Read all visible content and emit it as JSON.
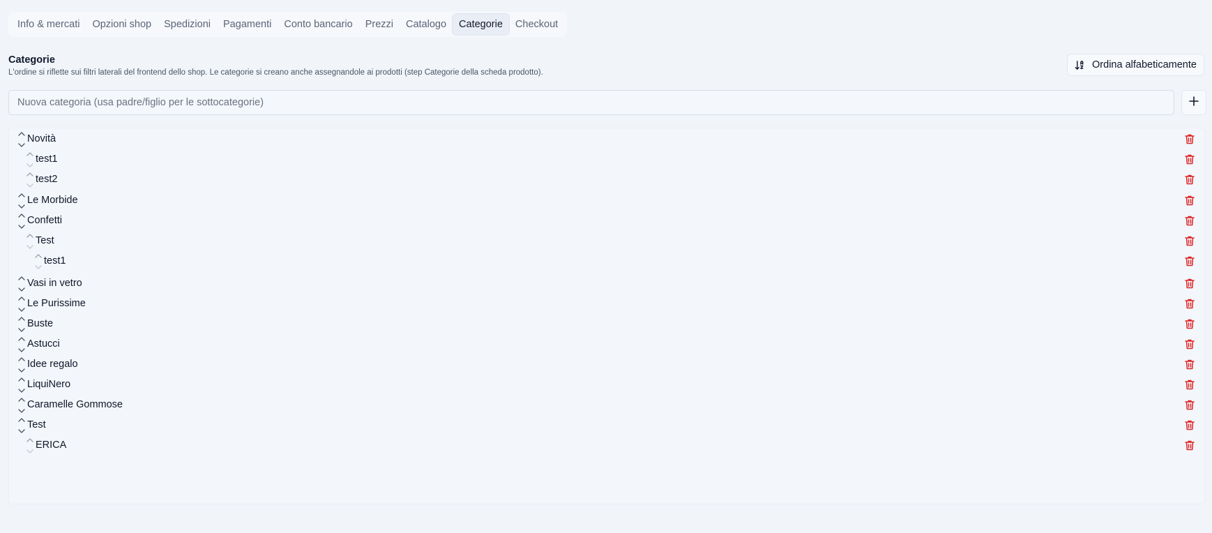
{
  "tabs": [
    {
      "label": "Info & mercati",
      "active": false
    },
    {
      "label": "Opzioni shop",
      "active": false
    },
    {
      "label": "Spedizioni",
      "active": false
    },
    {
      "label": "Pagamenti",
      "active": false
    },
    {
      "label": "Conto bancario",
      "active": false
    },
    {
      "label": "Prezzi",
      "active": false
    },
    {
      "label": "Catalogo",
      "active": false
    },
    {
      "label": "Categorie",
      "active": true
    },
    {
      "label": "Checkout",
      "active": false
    }
  ],
  "section": {
    "title": "Categorie",
    "description": "L'ordine si riflette sui filtri laterali del frontend dello shop. Le categorie si creano anche assegnandole ai prodotti (step Categorie della scheda prodotto)."
  },
  "sort_button": {
    "label": "Ordina alfabeticamente",
    "icon": "sort-alpha-icon"
  },
  "new_category": {
    "placeholder": "Nuova categoria (usa padre/figlio per le sottocategorie)",
    "value": ""
  },
  "add_button": {
    "icon": "plus-icon"
  },
  "categories": [
    {
      "label": "Novità",
      "depth": 0
    },
    {
      "label": "test1",
      "depth": 1
    },
    {
      "label": "test2",
      "depth": 1
    },
    {
      "label": "Le Morbide",
      "depth": 0
    },
    {
      "label": "Confetti",
      "depth": 0
    },
    {
      "label": "Test",
      "depth": 1
    },
    {
      "label": "test1",
      "depth": 2
    },
    {
      "label": "Vasi in vetro",
      "depth": 0
    },
    {
      "label": "Le Purissime",
      "depth": 0
    },
    {
      "label": "Buste",
      "depth": 0
    },
    {
      "label": "Astucci",
      "depth": 0
    },
    {
      "label": "Idee regalo",
      "depth": 0
    },
    {
      "label": "LiquiNero",
      "depth": 0
    },
    {
      "label": "Caramelle Gommose",
      "depth": 0
    },
    {
      "label": "Test",
      "depth": 0
    },
    {
      "label": "ERICA",
      "depth": 1
    }
  ],
  "colors": {
    "accent": "#dc2626",
    "text": "#0f172a",
    "muted": "#5b6475"
  }
}
